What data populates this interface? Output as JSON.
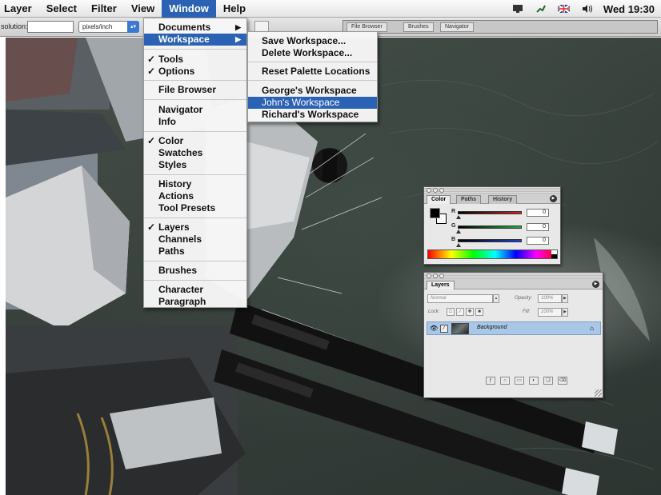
{
  "menubar": {
    "items": [
      "Layer",
      "Select",
      "Filter",
      "View",
      "Window",
      "Help"
    ],
    "clock": "Wed 19:30"
  },
  "optionsbar": {
    "resolution_label": "solution:",
    "units": "pixels/inch",
    "palette_well_tabs": [
      "File Browser",
      "Brushes",
      "Navigator"
    ]
  },
  "window_menu": {
    "items": [
      "Documents",
      "Workspace",
      "Tools",
      "Options",
      "File Browser",
      "Navigator",
      "Info",
      "Color",
      "Swatches",
      "Styles",
      "History",
      "Actions",
      "Tool Presets",
      "Layers",
      "Channels",
      "Paths",
      "Brushes",
      "Character",
      "Paragraph"
    ]
  },
  "workspace_menu": {
    "items": [
      "Save Workspace...",
      "Delete Workspace...",
      "Reset Palette Locations",
      "George's Workspace",
      "John's Workspace",
      "Richard's Workspace"
    ],
    "highlighted": "John's Workspace"
  },
  "color_palette": {
    "tabs": [
      "Color",
      "Paths",
      "History"
    ],
    "channels": [
      {
        "label": "R",
        "value": "0",
        "color": "#e02020"
      },
      {
        "label": "G",
        "value": "0",
        "color": "#20b040"
      },
      {
        "label": "B",
        "value": "0",
        "color": "#2040e0"
      }
    ]
  },
  "layers_palette": {
    "tab": "Layers",
    "blend_mode": "Normal",
    "opacity_label": "Opacity:",
    "opacity_value": "100%",
    "lock_label": "Lock:",
    "fill_label": "Fill:",
    "fill_value": "100%",
    "layer_name": "Background"
  },
  "colors": {
    "menu_highlight": "#2b62b3",
    "layer_selected": "#a9c7e6"
  }
}
